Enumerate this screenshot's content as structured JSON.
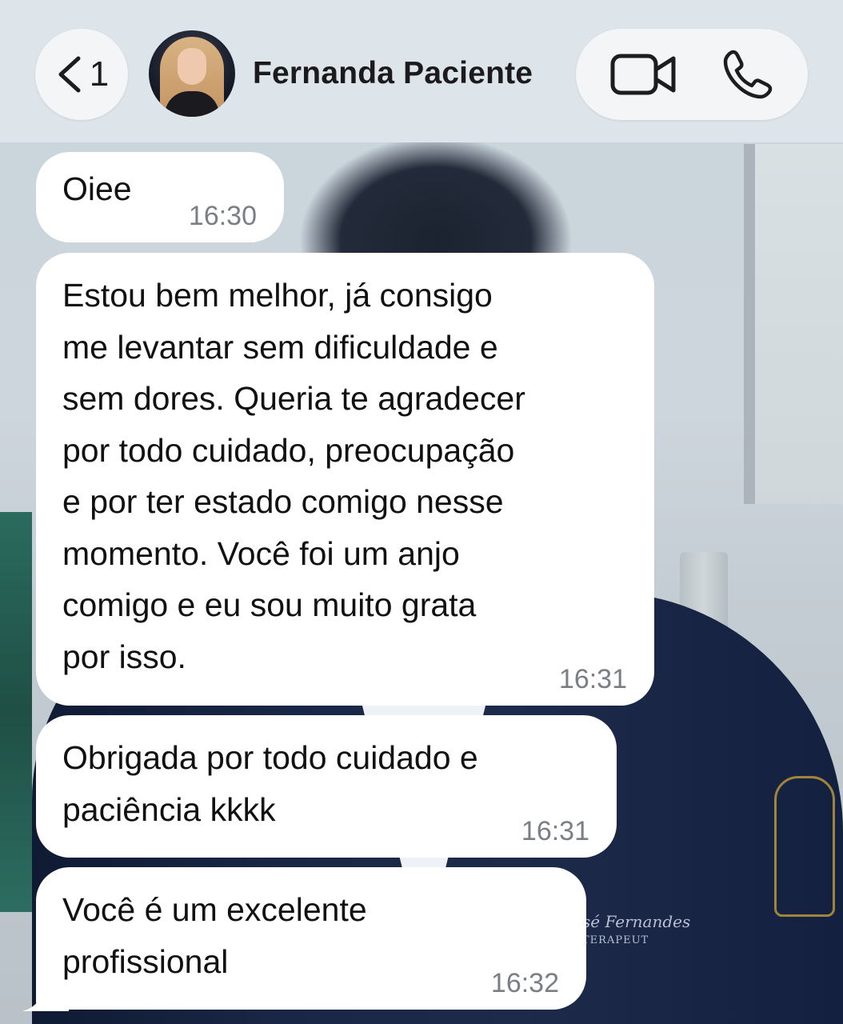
{
  "header": {
    "back_count": "1",
    "contact_name": "Fernanda Paciente",
    "icons": {
      "back": "chevron-left-icon",
      "video": "video-camera-icon",
      "phone": "phone-icon"
    }
  },
  "messages": [
    {
      "text": "Oiee",
      "time": "16:30"
    },
    {
      "text": "Estou bem melhor, já consigo\nme levantar sem dificuldade e\nsem dores. Queria te agradecer\npor todo cuidado, preocupação\ne por ter estado comigo nesse\nmomento. Você foi um anjo\ncomigo e eu sou muito grata\npor isso.",
      "time": "16:31"
    },
    {
      "text": "Obrigada por todo cuidado e\npaciência kkkk",
      "time": "16:31"
    },
    {
      "text": "Você é um excelente\nprofissional",
      "time": "16:32"
    }
  ],
  "wallpaper": {
    "embroidery_line1": "sé Fernandes",
    "embroidery_line2": "TERAPEUT"
  },
  "colors": {
    "header_bg": "#dde4ea",
    "bubble_bg": "#ffffff",
    "timestamp": "#7a7f85",
    "text": "#111111"
  }
}
